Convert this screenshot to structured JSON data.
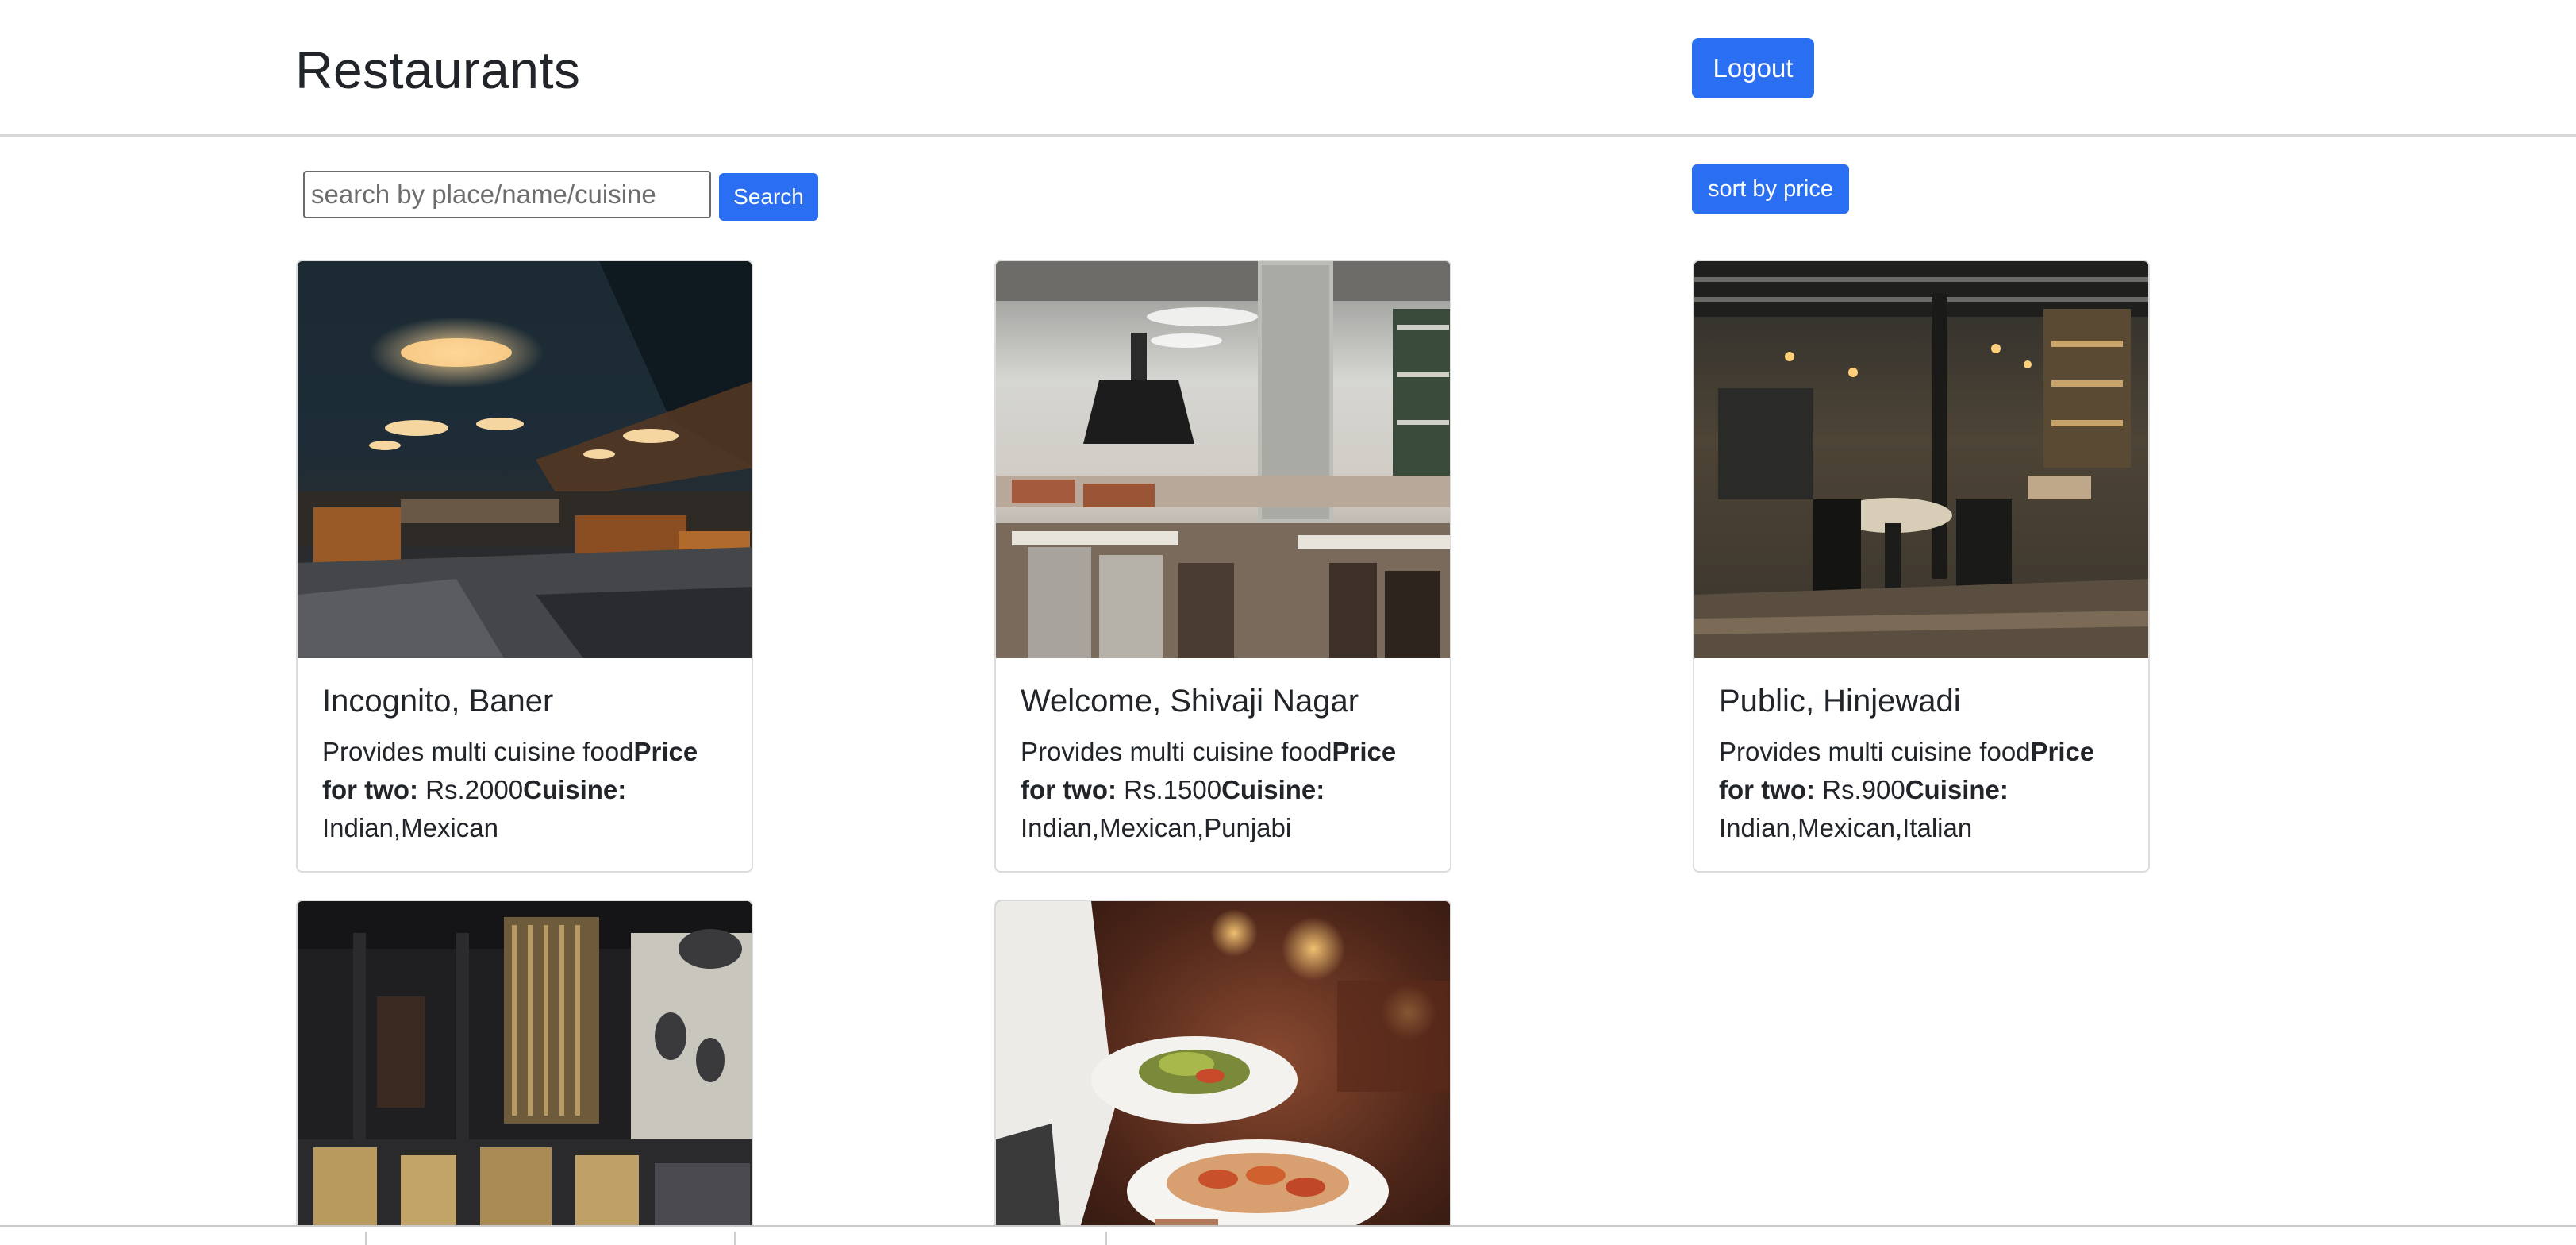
{
  "header": {
    "title": "Restaurants",
    "logout_label": "Logout"
  },
  "toolbar": {
    "search_placeholder": "search by place/name/cuisine",
    "search_value": "",
    "search_label": "Search",
    "sort_label": "sort by price"
  },
  "restaurants": [
    {
      "name": "Incognito, Baner",
      "description": "Provides multi cuisine food",
      "price_label": "Price for two:",
      "price": " Rs.2000",
      "cuisine_label": "Cuisine:",
      "cuisine": " Indian,Mexican",
      "image": "restaurant-interior-dark"
    },
    {
      "name": "Welcome, Shivaji Nagar",
      "description": "Provides multi cuisine food",
      "price_label": "Price for two:",
      "price": " Rs.1500",
      "cuisine_label": "Cuisine:",
      "cuisine": " Indian,Mexican,Punjabi",
      "image": "restaurant-interior-bright"
    },
    {
      "name": "Public, Hinjewadi",
      "description": "Provides multi cuisine food",
      "price_label": "Price for two:",
      "price": " Rs.900",
      "cuisine_label": "Cuisine:",
      "cuisine": " Indian,Mexican,Italian",
      "image": "restaurant-interior-wood"
    },
    {
      "image": "restaurant-interior-modern"
    },
    {
      "image": "waiter-serving-plates"
    }
  ],
  "colors": {
    "primary": "#2a6ef2",
    "card_border": "#dcdcdc",
    "header_border": "#d7d7d7"
  }
}
